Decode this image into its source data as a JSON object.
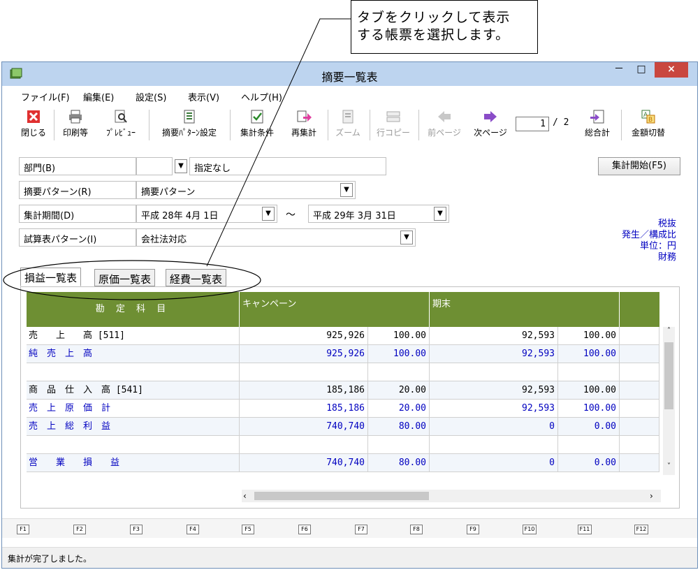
{
  "callout": {
    "line1": "タブをクリックして表示",
    "line2": "する帳票を選択します。"
  },
  "window": {
    "title": "摘要一覧表",
    "minimize": "－",
    "maximize": "□",
    "close": "×"
  },
  "menu": [
    "ファイル(F)",
    "編集(E)",
    "設定(S)",
    "表示(V)",
    "ヘルプ(H)"
  ],
  "toolbar": {
    "close": "閉じる",
    "print": "印刷等",
    "preview": "ﾌﾟﾚﾋﾞｭｰ",
    "pattern_setting": "摘要ﾊﾟﾀｰﾝ設定",
    "agg_condition": "集計条件",
    "recalc": "再集計",
    "zoom": "ズーム",
    "row_copy": "行コピー",
    "prev_page": "前ページ",
    "next_page": "次ページ",
    "page_current": "1",
    "page_total": "/ 2",
    "total": "総合計",
    "amount_switch": "金額切替"
  },
  "form": {
    "dept_label": "部門(B)",
    "dept_value": "",
    "dept_text": "指定なし",
    "pattern_label": "摘要パターン(R)",
    "pattern_value": "摘要パターン",
    "period_label": "集計期間(D)",
    "period_from": "平成 28年  4月  1日",
    "period_sep": "～",
    "period_to": "平成 29年  3月 31日",
    "tb_pattern_label": "試算表パターン(I)",
    "tb_pattern_value": "会社法対応"
  },
  "start_button": "集計開始(F5)",
  "info": {
    "tax": "税抜",
    "ratio": "発生／構成比",
    "unit": "単位：円",
    "finance": "財務"
  },
  "tabs": [
    "損益一覧表",
    "原価一覧表",
    "経費一覧表"
  ],
  "grid": {
    "headers": [
      "勘 定 科 目",
      "キャンペーン",
      "期末"
    ],
    "rows": [
      {
        "name": "売　　上　　高 [511]",
        "v1": "925,926",
        "p1": "100.00",
        "v2": "92,593",
        "p2": "100.00",
        "blue": false
      },
      {
        "name": "純　売　上　高",
        "v1": "925,926",
        "p1": "100.00",
        "v2": "92,593",
        "p2": "100.00",
        "blue": true
      },
      {
        "name": "",
        "v1": "",
        "p1": "",
        "v2": "",
        "p2": "",
        "blue": false
      },
      {
        "name": "商　品　仕　入　高 [541]",
        "v1": "185,186",
        "p1": "20.00",
        "v2": "92,593",
        "p2": "100.00",
        "blue": false
      },
      {
        "name": "売　上　原　価　計",
        "v1": "185,186",
        "p1": "20.00",
        "v2": "92,593",
        "p2": "100.00",
        "blue": true
      },
      {
        "name": "売　上　総　利　益",
        "v1": "740,740",
        "p1": "80.00",
        "v2": "0",
        "p2": "0.00",
        "blue": true
      },
      {
        "name": "",
        "v1": "",
        "p1": "",
        "v2": "",
        "p2": "",
        "blue": false
      },
      {
        "name": "営　　業　　損　　益",
        "v1": "740,740",
        "p1": "80.00",
        "v2": "0",
        "p2": "0.00",
        "blue": true
      }
    ]
  },
  "fkeys": [
    "F1",
    "F2",
    "F3",
    "F4",
    "F5",
    "F6",
    "F7",
    "F8",
    "F9",
    "F10",
    "F11",
    "F12"
  ],
  "status": "集計が完了しました。"
}
